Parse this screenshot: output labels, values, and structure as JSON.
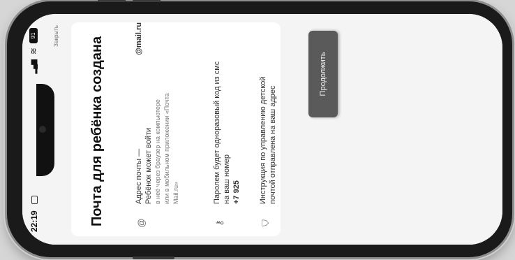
{
  "status": {
    "time": "22:19",
    "battery": "91"
  },
  "top_link": "Закрыть",
  "title": "Почта для ребёнка создана",
  "email_row": {
    "icon": "at-sign-icon",
    "label": "Адрес почты —",
    "domain": "@mail.ru",
    "line1": "Ребёнок может войти",
    "line2": "в неё через браузер на компьютере",
    "line3": "или в мобильном приложении «Почта",
    "line4": "Mail.ru»"
  },
  "phone_row": {
    "icon": "key-icon",
    "line1": "Паролем будет одноразовый код из смс",
    "line2": "на ваш номер",
    "number": "+7 925"
  },
  "help_row": {
    "icon": "shield-icon",
    "line1": "Инструкция по управлению детской",
    "line2": "почтой отправлена на ваш адрес"
  },
  "continue_label": "Продолжить"
}
